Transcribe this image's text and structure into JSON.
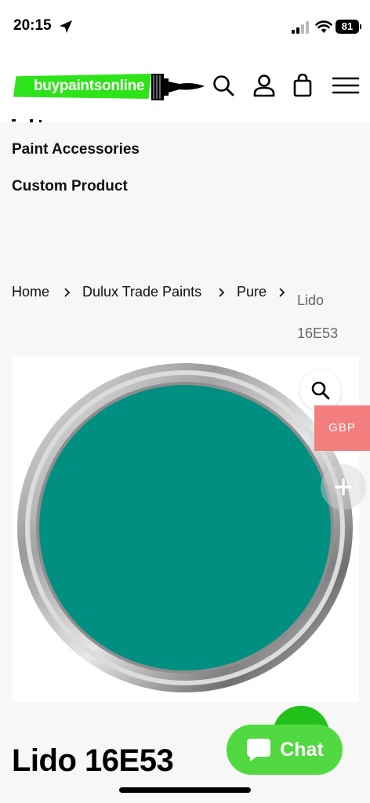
{
  "status_bar": {
    "time": "20:15",
    "battery": "81"
  },
  "header": {
    "logo_text": "buypaintsonline"
  },
  "nav": {
    "items": [
      "Paint Accessories",
      "Custom Product"
    ]
  },
  "breadcrumb": {
    "items": [
      "Home",
      "Dulux Trade Paints",
      "Pure",
      "Lido 16E53"
    ]
  },
  "product": {
    "title": "Lido 16E53",
    "paint_color": "#008f81",
    "currency": "GBP"
  },
  "chat": {
    "label": "Chat"
  },
  "colors": {
    "brand_green": "#2fe31a",
    "chat_green": "#52d840",
    "currency_badge": "#f47e7e"
  }
}
